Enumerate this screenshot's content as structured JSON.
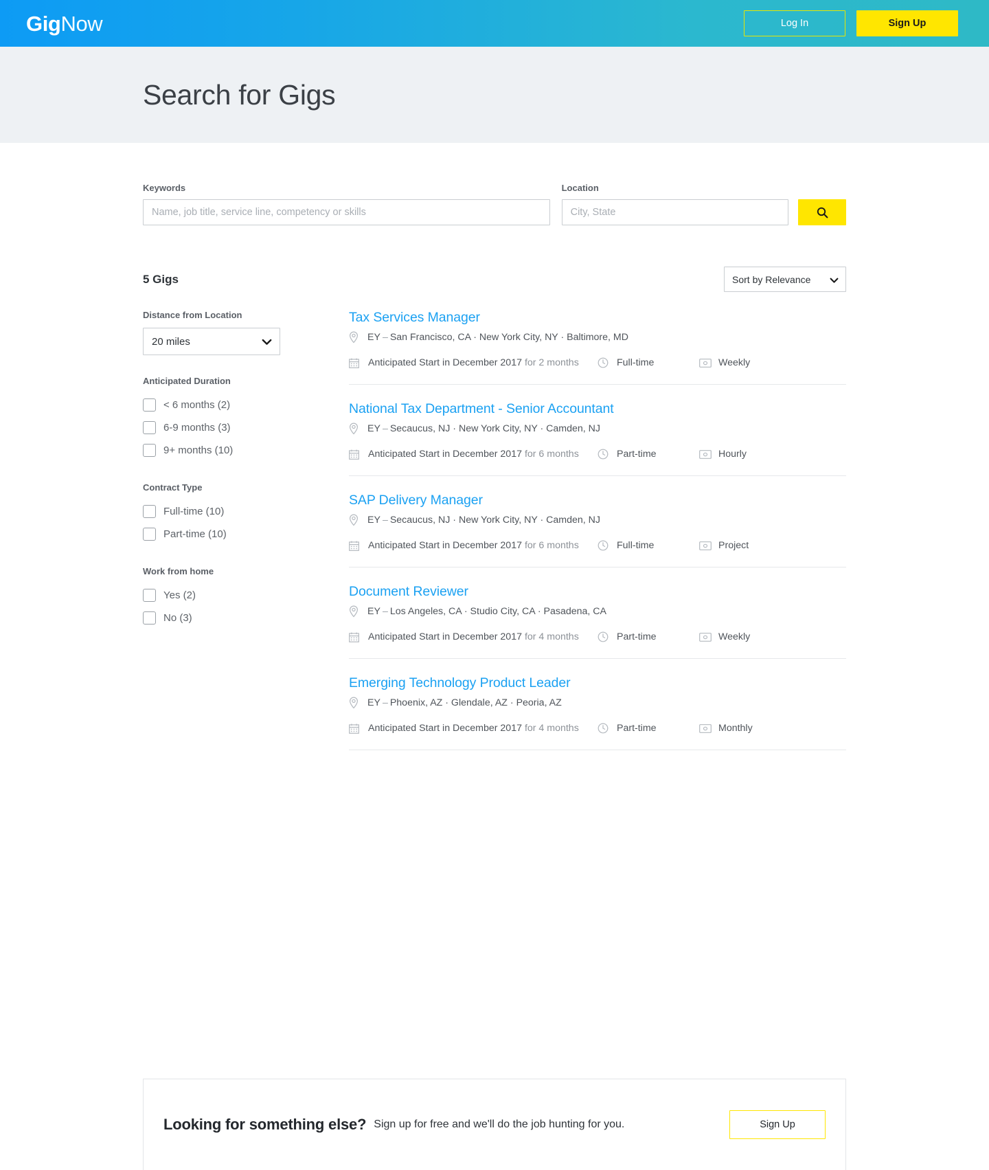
{
  "nav": {
    "logo_gig": "Gig",
    "logo_now": "Now",
    "login_label": "Log In",
    "signup_label": "Sign Up"
  },
  "hero": {
    "title": "Search for Gigs"
  },
  "search": {
    "keywords_label": "Keywords",
    "keywords_value": "",
    "keywords_placeholder": "Name, job title, service line, competency or skills",
    "location_label": "Location",
    "location_value": "",
    "location_placeholder": "City, State",
    "search_icon": "search-icon"
  },
  "results": {
    "count_label": "5 Gigs",
    "sort_selected": "Sort by Relevance",
    "sort_options": [
      "Sort by Relevance"
    ]
  },
  "filters": {
    "distance": {
      "title": "Distance from Location",
      "selected": "20 miles",
      "options": [
        "20 miles"
      ]
    },
    "groups": [
      {
        "title": "Anticipated Duration",
        "items": [
          {
            "label": "< 6 months (2)",
            "checked": false
          },
          {
            "label": "6-9 months (3)",
            "checked": false
          },
          {
            "label": "9+ months (10)",
            "checked": false
          }
        ]
      },
      {
        "title": "Contract Type",
        "items": [
          {
            "label": "Full-time (10)",
            "checked": false
          },
          {
            "label": "Part-time (10)",
            "checked": false
          }
        ]
      },
      {
        "title": "Work from home",
        "items": [
          {
            "label": "Yes (2)",
            "checked": false
          },
          {
            "label": "No (3)",
            "checked": false
          }
        ]
      }
    ]
  },
  "jobs": [
    {
      "title": "Tax Services Manager",
      "company": "EY",
      "dash": "–",
      "locations": "San Francisco, CA  ·  New York City, NY  ·  Baltimore, MD",
      "start": "Anticipated Start in December 2017",
      "duration": "for 2 months",
      "contract_type": "Full-time",
      "pay_cycle": "Weekly"
    },
    {
      "title": "National Tax Department - Senior Accountant",
      "company": "EY",
      "dash": "–",
      "locations": "Secaucus, NJ  ·  New York City, NY  ·  Camden, NJ",
      "start": "Anticipated Start in December 2017",
      "duration": "for 6 months",
      "contract_type": "Part-time",
      "pay_cycle": "Hourly"
    },
    {
      "title": "SAP Delivery Manager",
      "company": "EY",
      "dash": "–",
      "locations": "Secaucus, NJ  ·  New York City, NY  ·  Camden, NJ",
      "start": "Anticipated Start in December 2017",
      "duration": "for 6 months",
      "contract_type": "Full-time",
      "pay_cycle": "Project"
    },
    {
      "title": "Document Reviewer",
      "company": "EY",
      "dash": "–",
      "locations": "Los Angeles, CA  ·  Studio City, CA  ·  Pasadena, CA",
      "start": "Anticipated Start in December 2017",
      "duration": "for 4 months",
      "contract_type": "Part-time",
      "pay_cycle": "Weekly"
    },
    {
      "title": "Emerging Technology Product Leader",
      "company": "EY",
      "dash": "–",
      "locations": "Phoenix, AZ  ·  Glendale, AZ  ·  Peoria, AZ",
      "start": "Anticipated Start in December 2017",
      "duration": "for 4 months",
      "contract_type": "Part-time",
      "pay_cycle": "Monthly"
    }
  ],
  "cta": {
    "headline": "Looking for something else?",
    "subtext": "Sign up for free and we'll do the job hunting for you.",
    "button_label": "Sign Up"
  },
  "colors": {
    "brand_blue": "#0d9bf5",
    "brand_teal": "#2eb9c6",
    "accent_yellow": "#ffe600",
    "link_blue": "#1ba1f2",
    "hero_bg": "#eef1f4"
  }
}
